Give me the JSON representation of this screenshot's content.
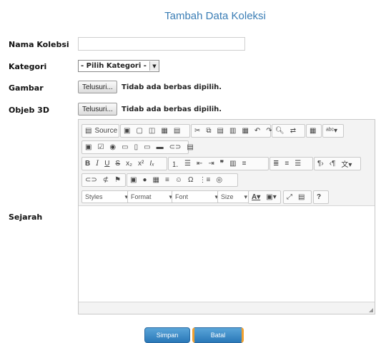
{
  "page_title": "Tambah Data Koleksi",
  "form": {
    "nama_label": "Nama Kolebsi",
    "nama_value": "",
    "kategori_label": "Kategori",
    "kategori_selected": "- Pilih Kategori -",
    "gambar_label": "Gambar",
    "objek_label": "Objeb 3D",
    "browse_label": "Telusuri...",
    "no_file": "Tidab ada berbas dipilih.",
    "sejarah_label": "Sejarah"
  },
  "editor": {
    "source_label": "Source",
    "styles": "Styles",
    "format": "Format",
    "font": "Font",
    "size": "Size"
  },
  "buttons": {
    "save": "Simpan",
    "cancel": "Batal"
  }
}
